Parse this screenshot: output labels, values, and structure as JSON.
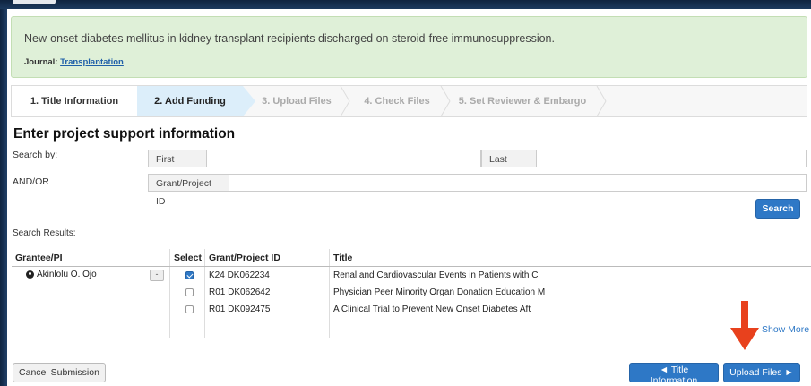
{
  "alert": {
    "title": "New-onset diabetes mellitus in kidney transplant recipients discharged on steroid-free immunosuppression.",
    "journal_label": "Journal:",
    "journal_link": "Transplantation"
  },
  "steps": [
    {
      "label": "1. Title Information"
    },
    {
      "label": "2. Add Funding"
    },
    {
      "label": "3. Upload Files"
    },
    {
      "label": "4. Check Files"
    },
    {
      "label": "5. Set Reviewer & Embargo"
    }
  ],
  "heading": "Enter project support information",
  "search": {
    "search_by": "Search by:",
    "first_name": "First Name",
    "last_name": "Last Name",
    "andor": "AND/OR",
    "grant_id": "Grant/Project ID",
    "button": "Search",
    "results_label": "Search Results:"
  },
  "table": {
    "headers": [
      "Grantee/PI",
      "Select",
      "Grant/Project ID",
      "Title"
    ],
    "pi_name": "Akinlolu O. Ojo",
    "collapse": "-",
    "rows": [
      {
        "checked": true,
        "grant": "K24 DK062234",
        "title": "Renal and Cardiovascular Events in Patients with C"
      },
      {
        "checked": false,
        "grant": "R01 DK062642",
        "title": "Physician Peer Minority Organ Donation Education M"
      },
      {
        "checked": false,
        "grant": "R01 DK092475",
        "title": "A Clinical Trial to Prevent New Onset Diabetes Aft"
      }
    ],
    "show_more": "Show More"
  },
  "footer": {
    "cancel": "Cancel Submission",
    "back": "◄ Title Information",
    "next": "Upload Files ►"
  },
  "colors": {
    "accent": "#2e78c6",
    "alert_bg": "#dff0d8",
    "arrow": "#e8411d"
  }
}
